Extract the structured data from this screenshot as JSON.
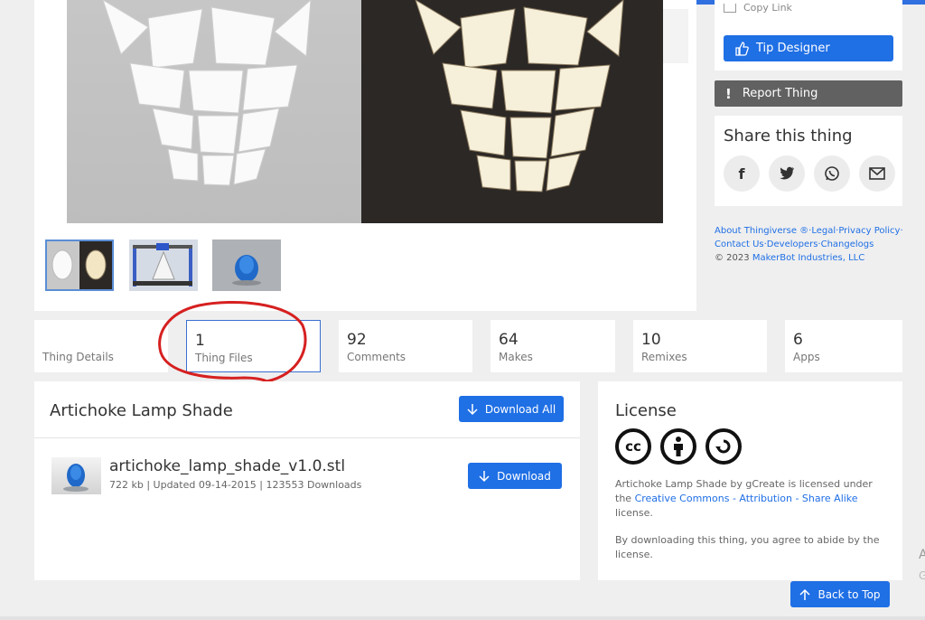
{
  "sidebar": {
    "copy_link": "Copy Link",
    "tip_designer": "Tip Designer",
    "report_thing": "Report Thing",
    "share_title": "Share this thing",
    "share_icons": [
      "facebook-icon",
      "twitter-icon",
      "whatsapp-icon",
      "mail-icon"
    ],
    "footer": {
      "line1": "About Thingiverse ®·Legal·Privacy Policy·",
      "line2": "Contact Us·Developers·Changelogs",
      "copyright_symbol": "©  2023",
      "copyright_owner": "MakerBot Industries, LLC"
    }
  },
  "tabs": [
    {
      "count": "",
      "label": "Thing Details"
    },
    {
      "count": "1",
      "label": "Thing Files"
    },
    {
      "count": "92",
      "label": "Comments"
    },
    {
      "count": "64",
      "label": "Makes"
    },
    {
      "count": "10",
      "label": "Remixes"
    },
    {
      "count": "6",
      "label": "Apps"
    }
  ],
  "files": {
    "title": "Artichoke Lamp Shade",
    "download_all": "Download All",
    "items": [
      {
        "name": "artichoke_lamp_shade_v1.0.stl",
        "meta": "722 kb | Updated 09-14-2015 | 123553 Downloads",
        "download": "Download"
      }
    ]
  },
  "license": {
    "title": "License",
    "icons": [
      "cc-icon",
      "attribution-icon",
      "share-alike-icon"
    ],
    "text_prefix": "Artichoke Lamp Shade by",
    "author": "gCreate",
    "text_mid": "is licensed under the",
    "link": "Creative Commons - Attribution - Share Alike",
    "text_suffix": "license.",
    "note": "By downloading this thing, you agree to abide by the license."
  },
  "back_to_top": "Back to Top",
  "edge": {
    "char1": "A",
    "char2": "G"
  },
  "colors": {
    "accent": "#1f6fe5",
    "report": "#616161",
    "annotation": "#d62020"
  }
}
